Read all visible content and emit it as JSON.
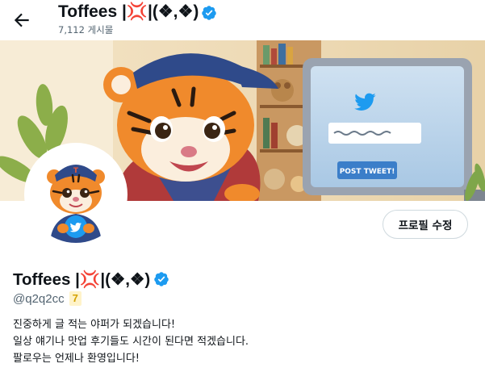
{
  "header": {
    "back_icon": "arrow-left-icon",
    "display_name": "Toffees |💢|(❖,❖)",
    "post_count": "7,112 게시물"
  },
  "banner": {
    "button_text": "POST TWEET!",
    "description_icons": [
      "tiger-mascot",
      "twitter-bird-icon",
      "bookshelf",
      "plant"
    ]
  },
  "profile": {
    "display_name": "Toffees |💢|(❖,❖)",
    "handle": "@q2q2cc",
    "badge": "7",
    "edit_button": "프로필 수정",
    "verified_icon": "verified-badge-icon",
    "bio": [
      "진중하게 글 적는 야퍼가 되겠습니다!",
      "일상 얘기나 맛업 후기들도 시간이 된다면 적겠습니다.",
      "팔로우는 언제나 환영입니다!"
    ]
  },
  "colors": {
    "accent": "#1d9bf0",
    "muted_text": "#536471",
    "badge_bg": "#fff3c9",
    "badge_fg": "#d4a200"
  }
}
